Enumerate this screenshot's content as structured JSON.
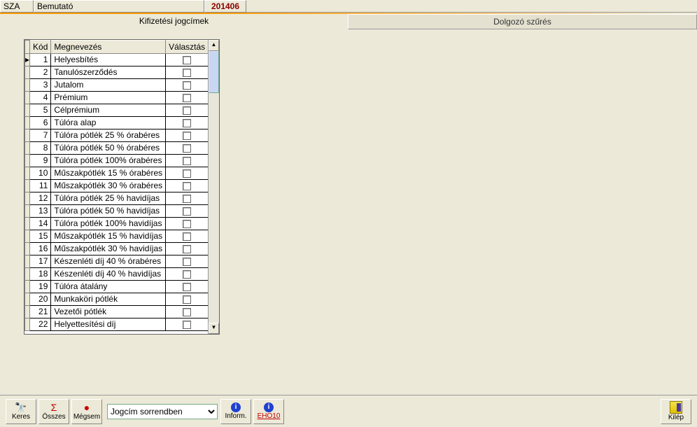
{
  "header": {
    "code": "SZA",
    "name": "Bemutató",
    "period": "201406"
  },
  "tabs": {
    "active": "Kifizetési jogcímek",
    "inactive": "Dolgozó szűrés"
  },
  "grid": {
    "headers": {
      "kod": "Kód",
      "megnevezes": "Megnevezés",
      "valasztas": "Választás"
    },
    "rows": [
      {
        "kod": "1",
        "megnevezes": "Helyesbítés"
      },
      {
        "kod": "2",
        "megnevezes": "Tanulószerződés"
      },
      {
        "kod": "3",
        "megnevezes": "Jutalom"
      },
      {
        "kod": "4",
        "megnevezes": "Prémium"
      },
      {
        "kod": "5",
        "megnevezes": "Célprémium"
      },
      {
        "kod": "6",
        "megnevezes": "Túlóra alap"
      },
      {
        "kod": "7",
        "megnevezes": "Túlóra pótlék 25 % órabéres"
      },
      {
        "kod": "8",
        "megnevezes": "Túlóra pótlék 50 % órabéres"
      },
      {
        "kod": "9",
        "megnevezes": "Túlóra pótlék 100% órabéres"
      },
      {
        "kod": "10",
        "megnevezes": "Műszakpótlék 15 % órabéres"
      },
      {
        "kod": "11",
        "megnevezes": "Műszakpótlék 30 % órabéres"
      },
      {
        "kod": "12",
        "megnevezes": "Túlóra pótlék 25 % havidíjas"
      },
      {
        "kod": "13",
        "megnevezes": "Túlóra pótlék 50 % havidíjas"
      },
      {
        "kod": "14",
        "megnevezes": "Túlóra pótlék 100% havidíjas"
      },
      {
        "kod": "15",
        "megnevezes": "Műszakpótlék 15 % havidíjas"
      },
      {
        "kod": "16",
        "megnevezes": "Műszakpótlék 30 % havidíjas"
      },
      {
        "kod": "17",
        "megnevezes": "Készenléti díj 40 % órabéres"
      },
      {
        "kod": "18",
        "megnevezes": "Készenléti díj 40 % havidíjas"
      },
      {
        "kod": "19",
        "megnevezes": "Túlóra átalány"
      },
      {
        "kod": "20",
        "megnevezes": "Munkaköri pótlék"
      },
      {
        "kod": "21",
        "megnevezes": "Vezetői pótlék"
      },
      {
        "kod": "22",
        "megnevezes": "Helyettesítési díj"
      }
    ]
  },
  "toolbar": {
    "keres": "Keres",
    "osszes": "Összes",
    "megsem": "Mégsem",
    "sort_value": "Jogcím sorrendben",
    "inform": "Inform.",
    "eho10": "EHO10",
    "exit": "Kilép"
  }
}
